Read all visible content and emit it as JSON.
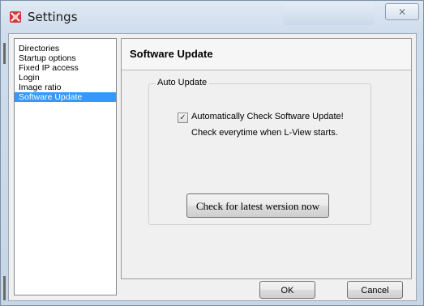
{
  "window": {
    "title": "Settings",
    "icon": "settings-app-icon",
    "close_glyph": "⨯",
    "accent": "#3399ff"
  },
  "sidebar": {
    "items": [
      {
        "label": "Directories",
        "selected": false
      },
      {
        "label": "Startup options",
        "selected": false
      },
      {
        "label": "Fixed IP access",
        "selected": false
      },
      {
        "label": "Login",
        "selected": false
      },
      {
        "label": "Image ratio",
        "selected": false
      },
      {
        "label": "Software Update",
        "selected": true
      }
    ]
  },
  "panel": {
    "title": "Software Update",
    "group_label": "Auto Update",
    "checkbox_label": "Automatically Check Software Update!",
    "checkbox_checked": true,
    "checkbox_subtext": "Check everytime when  L-View starts.",
    "check_now_label": "Check for latest wersion now"
  },
  "footer": {
    "ok_label": "OK",
    "cancel_label": "Cancel"
  }
}
